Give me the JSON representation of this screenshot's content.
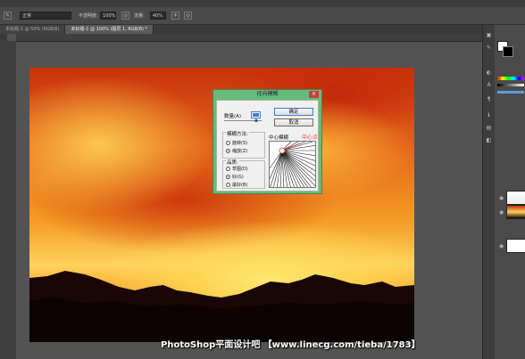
{
  "menubar": {
    "items": [
      "",
      "",
      "",
      "",
      "",
      "",
      "",
      "",
      "",
      ""
    ]
  },
  "options_bar": {
    "mode_value": "正常",
    "opacity_label": "不透明度:",
    "opacity_value": "100%",
    "flow_label": "流量:",
    "flow_value": "40%"
  },
  "tabs": [
    {
      "label": "未标题-1 @ 50% (RGB/8)",
      "active": false
    },
    {
      "label": "未标题-1 @ 100% (图层 1, RGB/8) *",
      "active": true
    }
  ],
  "dialog": {
    "title": "径向模糊",
    "close_glyph": "×",
    "amount_label": "数量(A)",
    "amount_value": 10,
    "ok_label": "确定",
    "cancel_label": "取消",
    "method_group_label": "模糊方法:",
    "methods": [
      {
        "label": "旋转(S)",
        "selected": false
      },
      {
        "label": "缩放(Z)",
        "selected": true
      }
    ],
    "quality_group_label": "品质:",
    "qualities": [
      {
        "label": "草图(D)",
        "selected": false
      },
      {
        "label": "好(G)",
        "selected": true
      },
      {
        "label": "最好(B)",
        "selected": false
      }
    ],
    "center_label": "中心模糊",
    "annotation": "中心点"
  },
  "watermark": "PhotoShop平面设计吧 【www.linecg.com/tieba/1783】",
  "colors": {
    "ui_dark": "#535353",
    "dialog_green": "#66bb7a",
    "accent_blue": "#3d7bd6",
    "annotation_red": "#e23a2a"
  },
  "icons": [
    "brush-tool-icon",
    "airbrush-icon",
    "pressure-icon",
    "panel-color-icon",
    "panel-layers-icon",
    "eye-icon",
    "close-icon"
  ]
}
